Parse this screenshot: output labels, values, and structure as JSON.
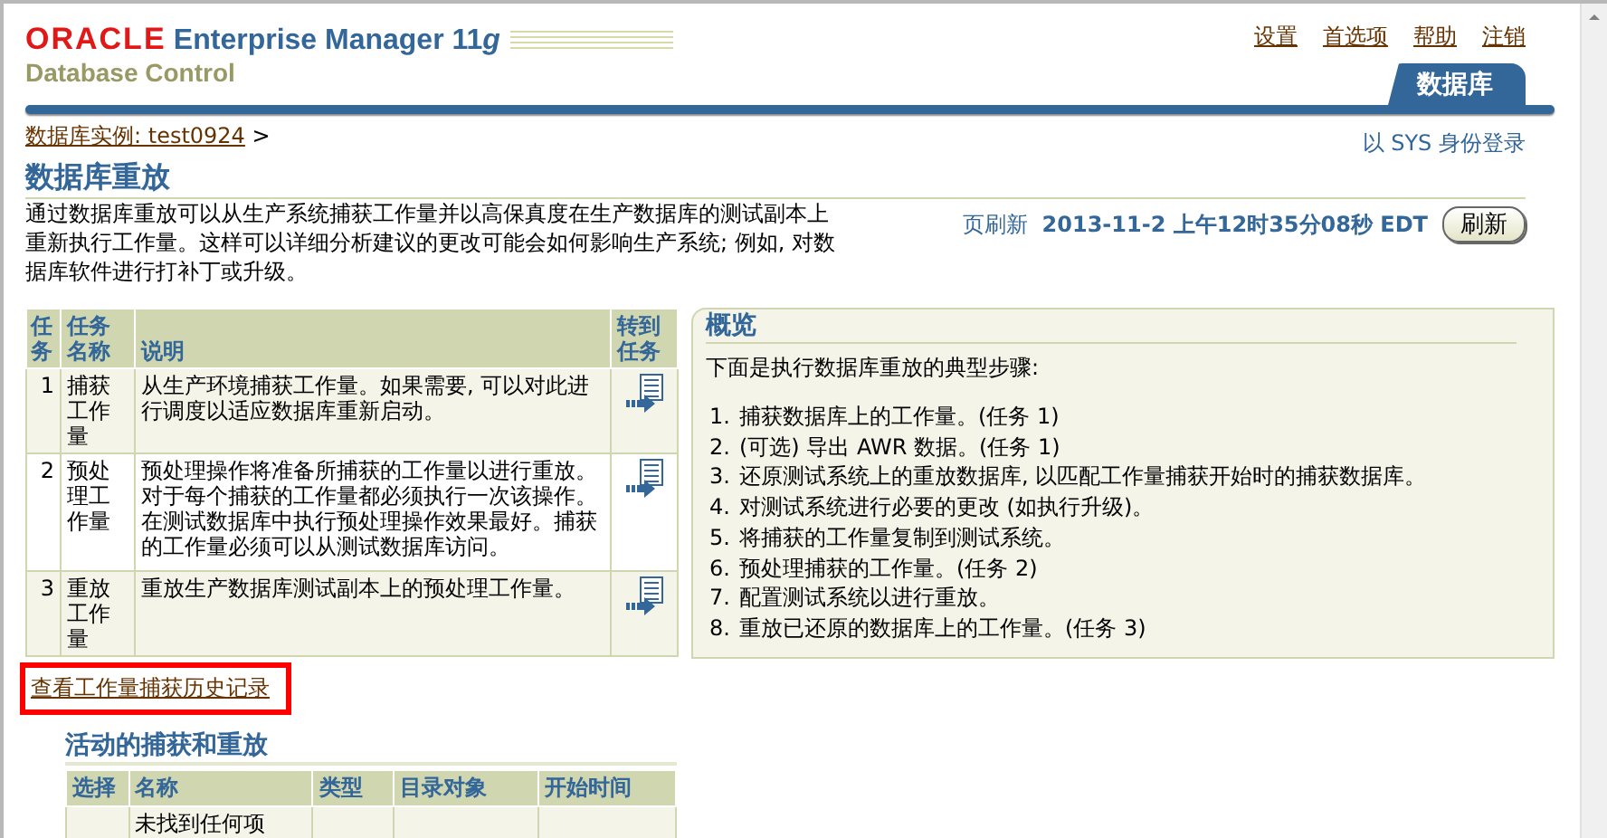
{
  "header": {
    "brand": "ORACLE",
    "product": "Enterprise Manager 11",
    "product_suffix": "g",
    "subtitle": "Database Control",
    "global_links": [
      "设置",
      "首选项",
      "帮助",
      "注销"
    ],
    "tabs": [
      {
        "label": "数据库",
        "selected": true
      }
    ]
  },
  "breadcrumb": {
    "link": "数据库实例: test0924",
    "separator": ">"
  },
  "login_info": "以  SYS 身份登录",
  "page_title": "数据库重放",
  "description": "通过数据库重放可以从生产系统捕获工作量并以高保真度在生产数据库的测试副本上重新执行工作量。这样可以详细分析建议的更改可能会如何影响生产系统; 例如, 对数据库软件进行打补丁或升级。",
  "refresh": {
    "label": "页刷新",
    "timestamp": "2013-11-2 上午12时35分08秒  EDT",
    "button": "刷新"
  },
  "tasks_table": {
    "columns": [
      "任务",
      "任务名称",
      "说明",
      "转到任务"
    ],
    "rows": [
      {
        "number": "1",
        "name": "捕获工作量",
        "description": "从生产环境捕获工作量。如果需要, 可以对此进行调度以适应数据库重新启动。"
      },
      {
        "number": "2",
        "name": "预处理工作量",
        "description": "预处理操作将准备所捕获的工作量以进行重放。对于每个捕获的工作量都必须执行一次该操作。在测试数据库中执行预处理操作效果最好。捕获的工作量必须可以从测试数据库访问。"
      },
      {
        "number": "3",
        "name": "重放工作量",
        "description": "重放生产数据库测试副本上的预处理工作量。"
      }
    ]
  },
  "overview": {
    "title": "概览",
    "intro": "下面是执行数据库重放的典型步骤:",
    "steps": [
      {
        "marker": "1.",
        "text": "捕获数据库上的工作量。(任务  1)"
      },
      {
        "marker": "2.",
        "text": "(可选) 导出  AWR 数据。(任务  1)"
      },
      {
        "marker": "3.",
        "text": "还原测试系统上的重放数据库, 以匹配工作量捕获开始时的捕获数据库。"
      },
      {
        "marker": "4.",
        "text": "对测试系统进行必要的更改  (如执行升级)。"
      },
      {
        "marker": "5.",
        "text": "将捕获的工作量复制到测试系统。"
      },
      {
        "marker": "6.",
        "text": "预处理捕获的工作量。(任务  2)"
      },
      {
        "marker": "7.",
        "text": "配置测试系统以进行重放。"
      },
      {
        "marker": "8.",
        "text": "重放已还原的数据库上的工作量。(任务  3)"
      }
    ]
  },
  "history_link": {
    "label": "查看工作量捕获历史记录",
    "highlighted": true
  },
  "active_section": {
    "title": "活动的捕获和重放",
    "columns": [
      "选择",
      "名称",
      "类型",
      "目录对象",
      "开始时间"
    ],
    "empty_message": "未找到任何项"
  }
}
